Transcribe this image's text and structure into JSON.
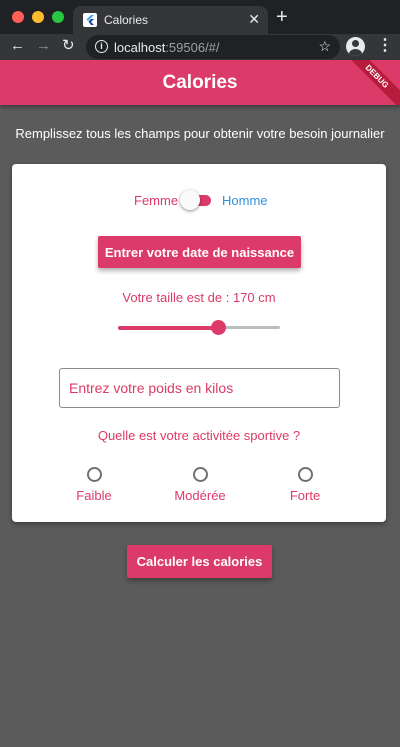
{
  "browser": {
    "tab_title": "Calories",
    "tab_close": "✕",
    "new_tab": "+",
    "url_host": "localhost",
    "url_rest": ":59506/#/",
    "back": "←",
    "forward": "→",
    "reload": "↻",
    "info": "i",
    "star": "☆",
    "menu": "⋮"
  },
  "appbar": {
    "title": "Calories",
    "debug": "DEBUG",
    "color": "#dc3a68"
  },
  "subtitle": "Remplissez tous les champs pour obtenir votre besoin journalier",
  "form": {
    "gender": {
      "left_label": "Femme",
      "right_label": "Homme"
    },
    "birthdate_button": "Entrer votre date de naissance",
    "height_label": "Votre taille est de : 170 cm",
    "height_slider_fraction": 0.62,
    "weight_placeholder": "Entrez votre poids en kilos",
    "activity_question": "Quelle est votre activitée sportive ?",
    "activity_options": [
      {
        "label": "Faible"
      },
      {
        "label": "Modérée"
      },
      {
        "label": "Forte"
      }
    ]
  },
  "calc_button": "Calculer les calories",
  "colors": {
    "accent": "#dc3a68",
    "secondary": "#2f8fe0",
    "background": "#5b5b5b"
  }
}
